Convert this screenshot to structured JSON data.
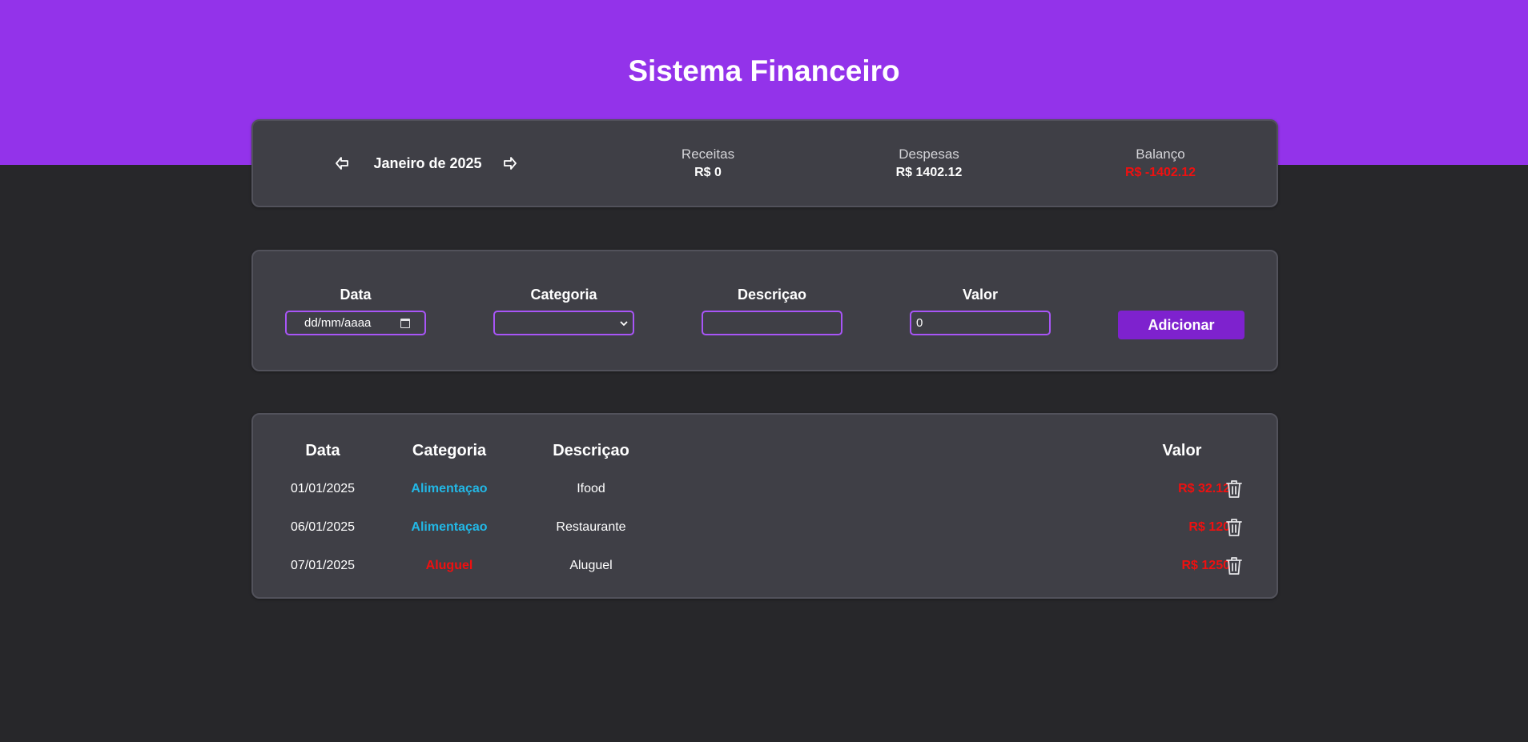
{
  "app": {
    "title": "Sistema Financeiro"
  },
  "summary": {
    "month_label": "Janeiro de 2025",
    "prev_icon": "arrow-left-icon",
    "next_icon": "arrow-right-icon",
    "receitas": {
      "label": "Receitas",
      "value": "R$ 0"
    },
    "despesas": {
      "label": "Despesas",
      "value": "R$ 1402.12"
    },
    "balanco": {
      "label": "Balanço",
      "value": "R$ -1402.12",
      "color": "#ef1010"
    }
  },
  "form": {
    "data": {
      "label": "Data",
      "placeholder": "dd/mm/aaaa"
    },
    "categoria": {
      "label": "Categoria",
      "value": ""
    },
    "descricao": {
      "label": "Descriçao",
      "value": ""
    },
    "valor": {
      "label": "Valor",
      "value": "0"
    },
    "add_button": "Adicionar"
  },
  "list": {
    "headers": {
      "data": "Data",
      "categoria": "Categoria",
      "descricao": "Descriçao",
      "valor": "Valor"
    },
    "rows": [
      {
        "data": "01/01/2025",
        "categoria": "Alimentaçao",
        "categoria_color": "#22b8e6",
        "descricao": "Ifood",
        "valor": "R$ 32.12"
      },
      {
        "data": "06/01/2025",
        "categoria": "Alimentaçao",
        "categoria_color": "#22b8e6",
        "descricao": "Restaurante",
        "valor": "R$ 120"
      },
      {
        "data": "07/01/2025",
        "categoria": "Aluguel",
        "categoria_color": "#ef1010",
        "descricao": "Aluguel",
        "valor": "R$ 1250"
      }
    ],
    "delete_icon": "trash-icon"
  },
  "colors": {
    "header_bg": "#9333ea",
    "page_bg": "#27272a",
    "card_bg": "#3f3f46",
    "accent": "#a855f7",
    "button_bg": "#7e22ce",
    "expense": "#ef1010"
  }
}
